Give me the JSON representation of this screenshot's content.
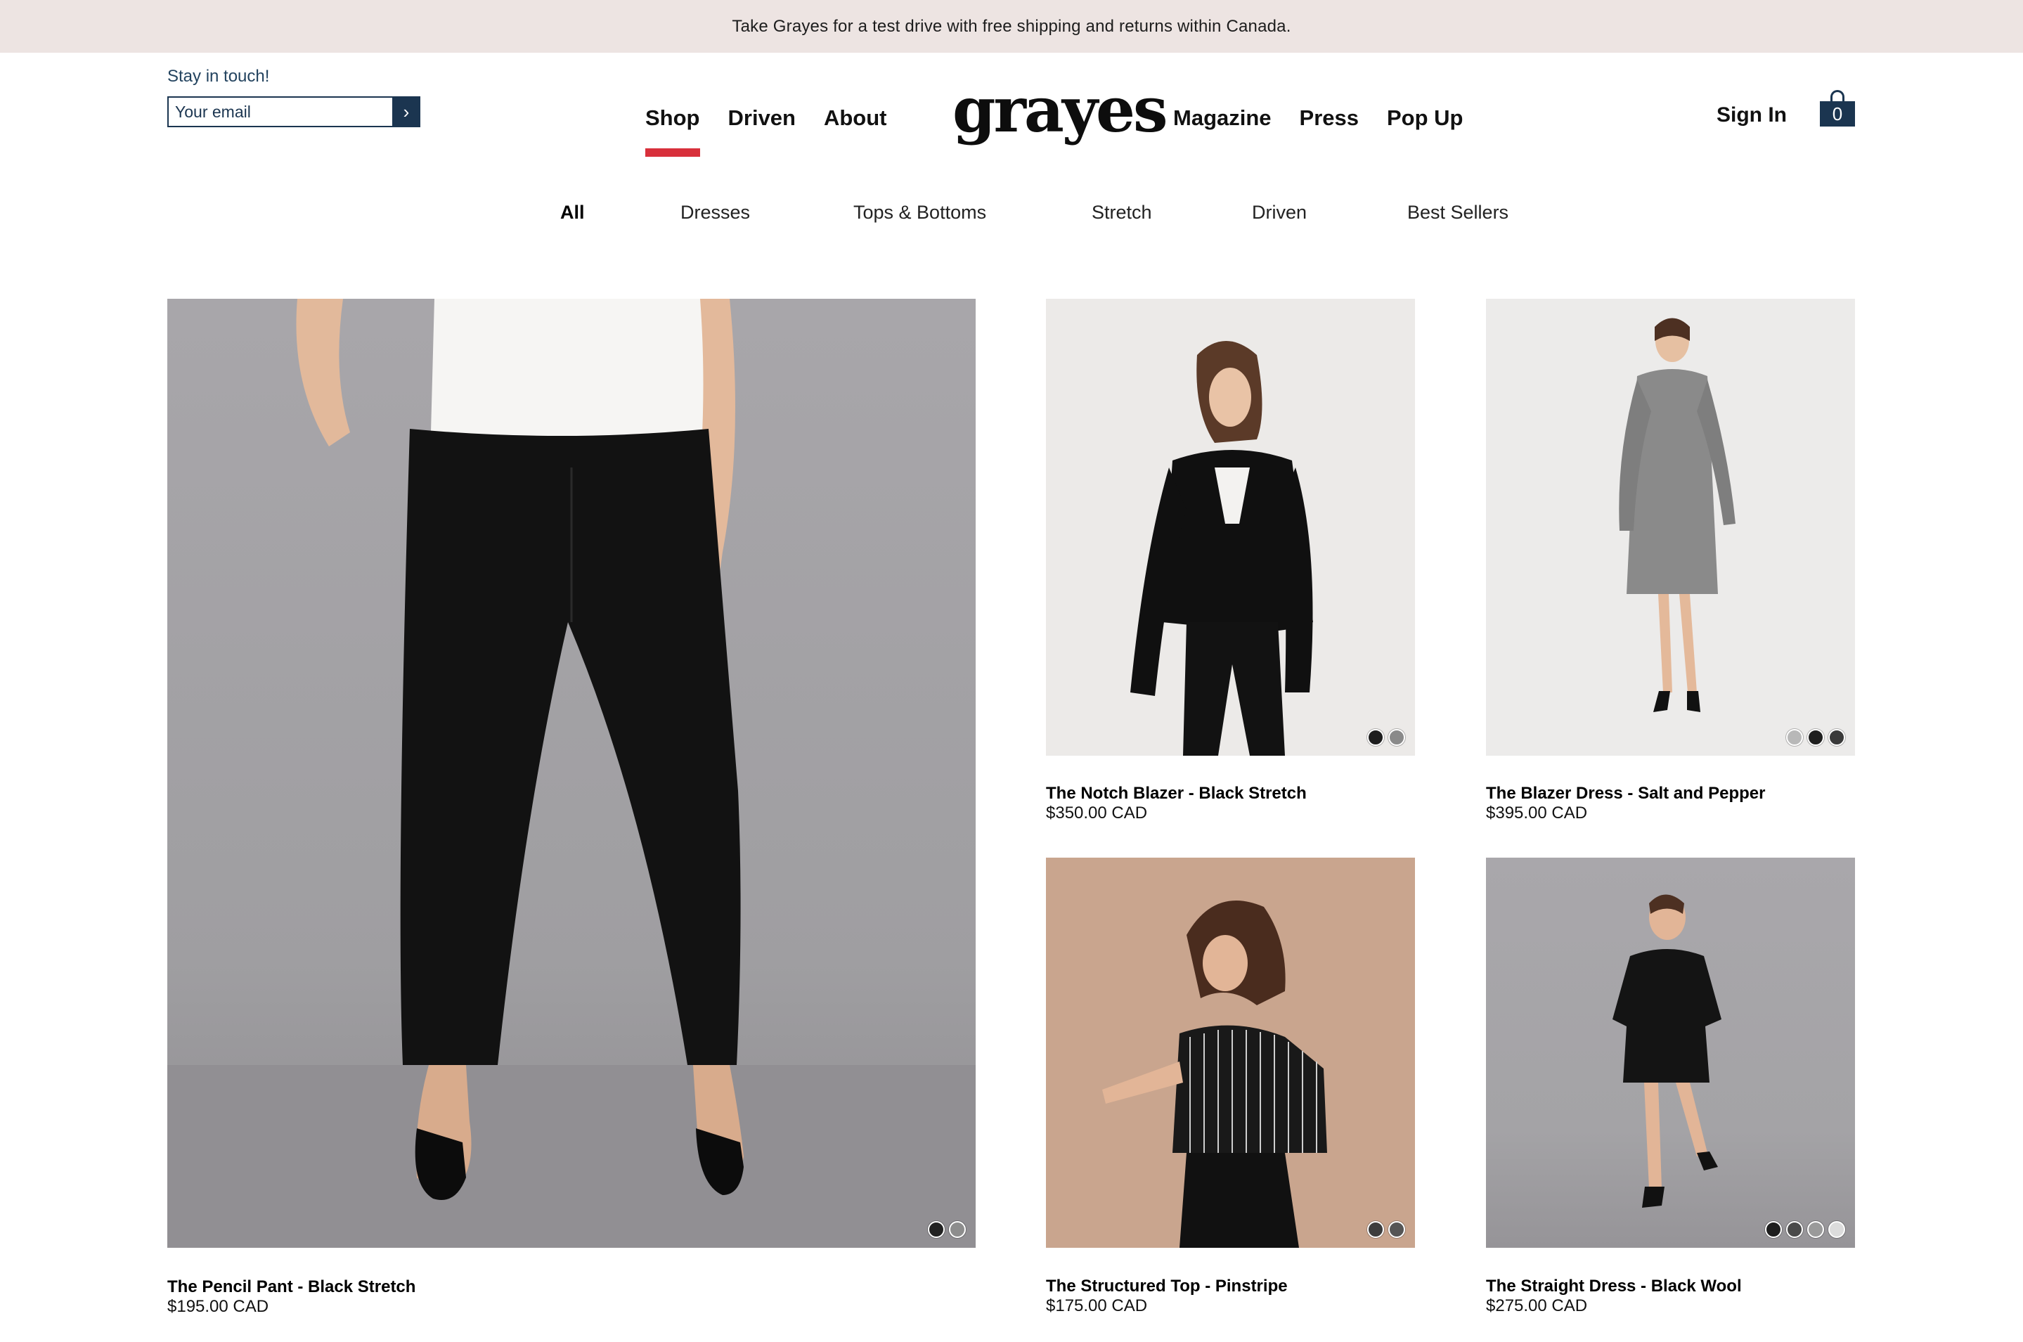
{
  "announcement": "Take Grayes for a test drive with free shipping and returns within Canada.",
  "newsletter": {
    "label": "Stay in touch!",
    "placeholder": "Your email",
    "submit_icon": "chevron-right-icon"
  },
  "brand": {
    "logo": "grayes"
  },
  "nav_left": [
    {
      "label": "Shop",
      "active": true
    },
    {
      "label": "Driven",
      "active": false
    },
    {
      "label": "About",
      "active": false
    }
  ],
  "nav_right": [
    {
      "label": "Magazine"
    },
    {
      "label": "Press"
    },
    {
      "label": "Pop Up"
    }
  ],
  "account": {
    "sign_in": "Sign In",
    "cart_count": "0",
    "cart_icon": "shopping-bag-icon"
  },
  "categories": [
    {
      "label": "All",
      "active": true
    },
    {
      "label": "Dresses",
      "active": false
    },
    {
      "label": "Tops & Bottoms",
      "active": false
    },
    {
      "label": "Stretch",
      "active": false
    },
    {
      "label": "Driven",
      "active": false
    },
    {
      "label": "Best Sellers",
      "active": false
    }
  ],
  "products": [
    {
      "title": "The Pencil Pant - Black Stretch",
      "price": "$195.00 CAD",
      "swatches": [
        "#222222",
        "#8d8d8d"
      ]
    },
    {
      "title": "The Notch Blazer - Black Stretch",
      "price": "$350.00 CAD",
      "swatches": [
        "#1e1e1e",
        "#8a8a8a"
      ]
    },
    {
      "title": "The Blazer Dress - Salt and Pepper",
      "price": "$395.00 CAD",
      "swatches": [
        "#b8b8b8",
        "#1f1f1f",
        "#3a3a3a"
      ]
    },
    {
      "title": "The Structured Top - Pinstripe",
      "price": "$175.00 CAD",
      "swatches": [
        "#3d3d3d",
        "#555555"
      ]
    },
    {
      "title": "The Straight Dress - Black Wool",
      "price": "$275.00 CAD",
      "swatches": [
        "#1e1e1e",
        "#4a4a4a",
        "#9a9a9a",
        "#dcdcdc"
      ]
    }
  ],
  "colors": {
    "banner_bg": "#ede4e2",
    "navy": "#1b3550",
    "accent_red": "#d8303b"
  }
}
